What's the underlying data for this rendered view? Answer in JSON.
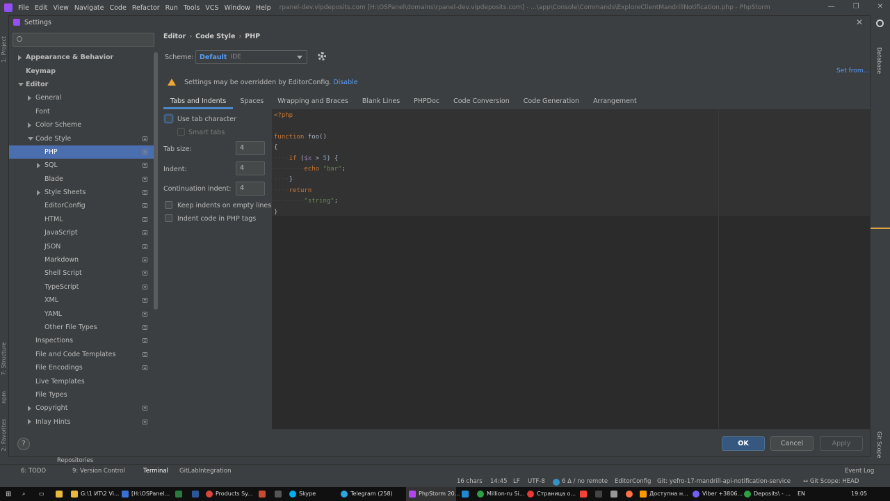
{
  "titlebar": {
    "menu": [
      "File",
      "Edit",
      "View",
      "Navigate",
      "Code",
      "Refactor",
      "Run",
      "Tools",
      "VCS",
      "Window",
      "Help"
    ],
    "project": "rpanel-dev.vipdeposits.com [H:\\OSPanel\\domains\\rpanel-dev.vipdeposits.com] - ...\\app\\Console\\Commands\\ExploreClientMandrillNotification.php - PhpStorm",
    "minimize": "—",
    "maximize": "❐",
    "close": "✕"
  },
  "left_strip": {
    "project": "1: Project",
    "structure": "7: Structure",
    "npm": "npm",
    "favorites": "2: Favorites"
  },
  "right_strip": {
    "database": "Database",
    "git_scope": "Git Scope"
  },
  "dialog": {
    "title": "Settings",
    "close": "✕",
    "search_placeholder": "",
    "tree": [
      {
        "label": "Appearance & Behavior",
        "level": 0,
        "arrow": "right",
        "bold": true,
        "copy": false,
        "selected": false
      },
      {
        "label": "Keymap",
        "level": 0,
        "arrow": "none",
        "bold": true,
        "copy": false,
        "selected": false
      },
      {
        "label": "Editor",
        "level": 0,
        "arrow": "down",
        "bold": true,
        "copy": false,
        "selected": false
      },
      {
        "label": "General",
        "level": 1,
        "arrow": "right",
        "bold": false,
        "copy": false,
        "selected": false
      },
      {
        "label": "Font",
        "level": 1,
        "arrow": "none",
        "bold": false,
        "copy": false,
        "selected": false
      },
      {
        "label": "Color Scheme",
        "level": 1,
        "arrow": "right",
        "bold": false,
        "copy": false,
        "selected": false
      },
      {
        "label": "Code Style",
        "level": 1,
        "arrow": "down",
        "bold": false,
        "copy": true,
        "selected": false
      },
      {
        "label": "PHP",
        "level": 2,
        "arrow": "none",
        "bold": false,
        "copy": true,
        "selected": true
      },
      {
        "label": "SQL",
        "level": 2,
        "arrow": "right",
        "bold": false,
        "copy": true,
        "selected": false
      },
      {
        "label": "Blade",
        "level": 2,
        "arrow": "none",
        "bold": false,
        "copy": true,
        "selected": false
      },
      {
        "label": "Style Sheets",
        "level": 2,
        "arrow": "right",
        "bold": false,
        "copy": true,
        "selected": false
      },
      {
        "label": "EditorConfig",
        "level": 2,
        "arrow": "none",
        "bold": false,
        "copy": true,
        "selected": false
      },
      {
        "label": "HTML",
        "level": 2,
        "arrow": "none",
        "bold": false,
        "copy": true,
        "selected": false
      },
      {
        "label": "JavaScript",
        "level": 2,
        "arrow": "none",
        "bold": false,
        "copy": true,
        "selected": false
      },
      {
        "label": "JSON",
        "level": 2,
        "arrow": "none",
        "bold": false,
        "copy": true,
        "selected": false
      },
      {
        "label": "Markdown",
        "level": 2,
        "arrow": "none",
        "bold": false,
        "copy": true,
        "selected": false
      },
      {
        "label": "Shell Script",
        "level": 2,
        "arrow": "none",
        "bold": false,
        "copy": true,
        "selected": false
      },
      {
        "label": "TypeScript",
        "level": 2,
        "arrow": "none",
        "bold": false,
        "copy": true,
        "selected": false
      },
      {
        "label": "XML",
        "level": 2,
        "arrow": "none",
        "bold": false,
        "copy": true,
        "selected": false
      },
      {
        "label": "YAML",
        "level": 2,
        "arrow": "none",
        "bold": false,
        "copy": true,
        "selected": false
      },
      {
        "label": "Other File Types",
        "level": 2,
        "arrow": "none",
        "bold": false,
        "copy": true,
        "selected": false
      },
      {
        "label": "Inspections",
        "level": 1,
        "arrow": "none",
        "bold": false,
        "copy": true,
        "selected": false
      },
      {
        "label": "File and Code Templates",
        "level": 1,
        "arrow": "none",
        "bold": false,
        "copy": true,
        "selected": false
      },
      {
        "label": "File Encodings",
        "level": 1,
        "arrow": "none",
        "bold": false,
        "copy": true,
        "selected": false
      },
      {
        "label": "Live Templates",
        "level": 1,
        "arrow": "none",
        "bold": false,
        "copy": false,
        "selected": false
      },
      {
        "label": "File Types",
        "level": 1,
        "arrow": "none",
        "bold": false,
        "copy": false,
        "selected": false
      },
      {
        "label": "Copyright",
        "level": 1,
        "arrow": "right",
        "bold": false,
        "copy": true,
        "selected": false
      },
      {
        "label": "Inlay Hints",
        "level": 1,
        "arrow": "right",
        "bold": false,
        "copy": true,
        "selected": false
      }
    ],
    "breadcrumb": [
      "Editor",
      "Code Style",
      "PHP"
    ],
    "breadcrumb_sep": "›",
    "scheme_label": "Scheme:",
    "scheme_value": "Default",
    "scheme_kind": "IDE",
    "set_from": "Set from...",
    "warning_text": "Settings may be overridden by EditorConfig.",
    "warning_link": "Disable",
    "tabs": [
      "Tabs and Indents",
      "Spaces",
      "Wrapping and Braces",
      "Blank Lines",
      "PHPDoc",
      "Code Conversion",
      "Code Generation",
      "Arrangement"
    ],
    "active_tab": 0,
    "options": {
      "use_tab_character": "Use tab character",
      "smart_tabs": "Smart tabs",
      "tab_size_label": "Tab size:",
      "tab_size": "4",
      "indent_label": "Indent:",
      "indent": "4",
      "continuation_label": "Continuation indent:",
      "continuation": "4",
      "keep_indents": "Keep indents on empty lines",
      "indent_php_tags": "Indent code in PHP tags"
    },
    "buttons": {
      "help": "?",
      "ok": "OK",
      "cancel": "Cancel",
      "apply": "Apply"
    }
  },
  "behind": {
    "repositories": "Repositories"
  },
  "toolwindows": [
    {
      "label": "6: TODO",
      "active": false
    },
    {
      "label": "9: Version Control",
      "active": false
    },
    {
      "label": "Terminal",
      "active": true
    },
    {
      "label": "GitLabIntegration",
      "active": false
    }
  ],
  "event_log": "Event Log",
  "status": {
    "chars": "16 chars",
    "position": "14:45",
    "line_sep": "LF",
    "encoding": "UTF-8",
    "vcs": "6 Δ / no remote",
    "editorconfig": "EditorConfig",
    "git": "Git: yefro-17-mandrill-api-notification-service",
    "git_scope": "↔ Git Scope: HEAD"
  },
  "taskbar": {
    "items": [
      "G:\\1 ИТ\\2 Vi...",
      "[H:\\OSPanel...",
      "Products Sy...",
      "Skype",
      "Telegram (258)",
      "PhpStorm 20...",
      "Million-ru Si...",
      "Страница о...",
      "Доступна н...",
      "Viber +3806...",
      "Deposits\\ - ..."
    ],
    "lang": "EN",
    "time": "19:05"
  },
  "colors": {
    "accent": "#4b6eaf",
    "link": "#589df6",
    "warning": "#f0a732",
    "ok_button": "#365880"
  }
}
